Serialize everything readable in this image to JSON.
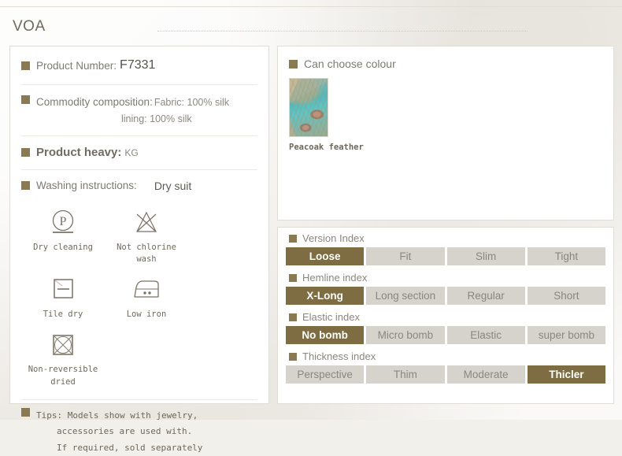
{
  "header": {
    "brand": "VOA"
  },
  "product": {
    "number_label": "Product Number:",
    "number_value": "F7331",
    "composition_label": "Commodity composition",
    "composition_colon": ":",
    "composition_line1": "Fabric:  100%  silk",
    "composition_line2": "lining:  100%  silk",
    "heavy_label": "Product  heavy:",
    "heavy_unit": "KG",
    "washing_label": "Washing instructions:",
    "washing_value": "Dry suit"
  },
  "care_icons": [
    {
      "icon": "dry-cleaning-p-circle-icon",
      "caption": "Dry cleaning"
    },
    {
      "icon": "no-chlorine-triangle-cross-icon",
      "caption": "Not chlorine wash"
    },
    {
      "icon": "tile-dry-square-icon",
      "caption": "Tile dry"
    },
    {
      "icon": "low-iron-two-dots-icon",
      "caption": "Low iron"
    },
    {
      "icon": "non-reversible-dried-icon",
      "caption": "Non-reversible\ndried"
    }
  ],
  "tips": {
    "label": "Tips:",
    "lines": [
      "Tips: Models show with jewelry,",
      "accessories are used with.",
      "If required, sold separately"
    ]
  },
  "colour": {
    "title": "Can choose colour",
    "swatches": [
      {
        "name": "Peacoak  feather"
      }
    ]
  },
  "indexes": [
    {
      "title": "Version Index",
      "options": [
        {
          "label": "Loose",
          "active": true
        },
        {
          "label": "Fit",
          "active": false
        },
        {
          "label": "Slim",
          "active": false
        },
        {
          "label": "Tight",
          "active": false
        }
      ]
    },
    {
      "title": "Hemline index",
      "options": [
        {
          "label": "X-Long",
          "active": true
        },
        {
          "label": "Long  section",
          "active": false
        },
        {
          "label": "Regular",
          "active": false
        },
        {
          "label": "Short",
          "active": false
        }
      ]
    },
    {
      "title": "Elastic index",
      "options": [
        {
          "label": "No  bomb",
          "active": true
        },
        {
          "label": "Micro  bomb",
          "active": false
        },
        {
          "label": "Elastic",
          "active": false
        },
        {
          "label": "super  bomb",
          "active": false
        }
      ]
    },
    {
      "title": "Thickness index",
      "options": [
        {
          "label": "Perspective",
          "active": false
        },
        {
          "label": "Thim",
          "active": false
        },
        {
          "label": "Moderate",
          "active": false
        },
        {
          "label": "Thicler",
          "active": true
        }
      ]
    }
  ],
  "colors": {
    "accent": "#7e6d42",
    "bullet": "#8a7a52",
    "chip_inactive": "#d6d3cc",
    "page_bg": "#f2f0eb",
    "panel_bg": "#ffffff"
  }
}
